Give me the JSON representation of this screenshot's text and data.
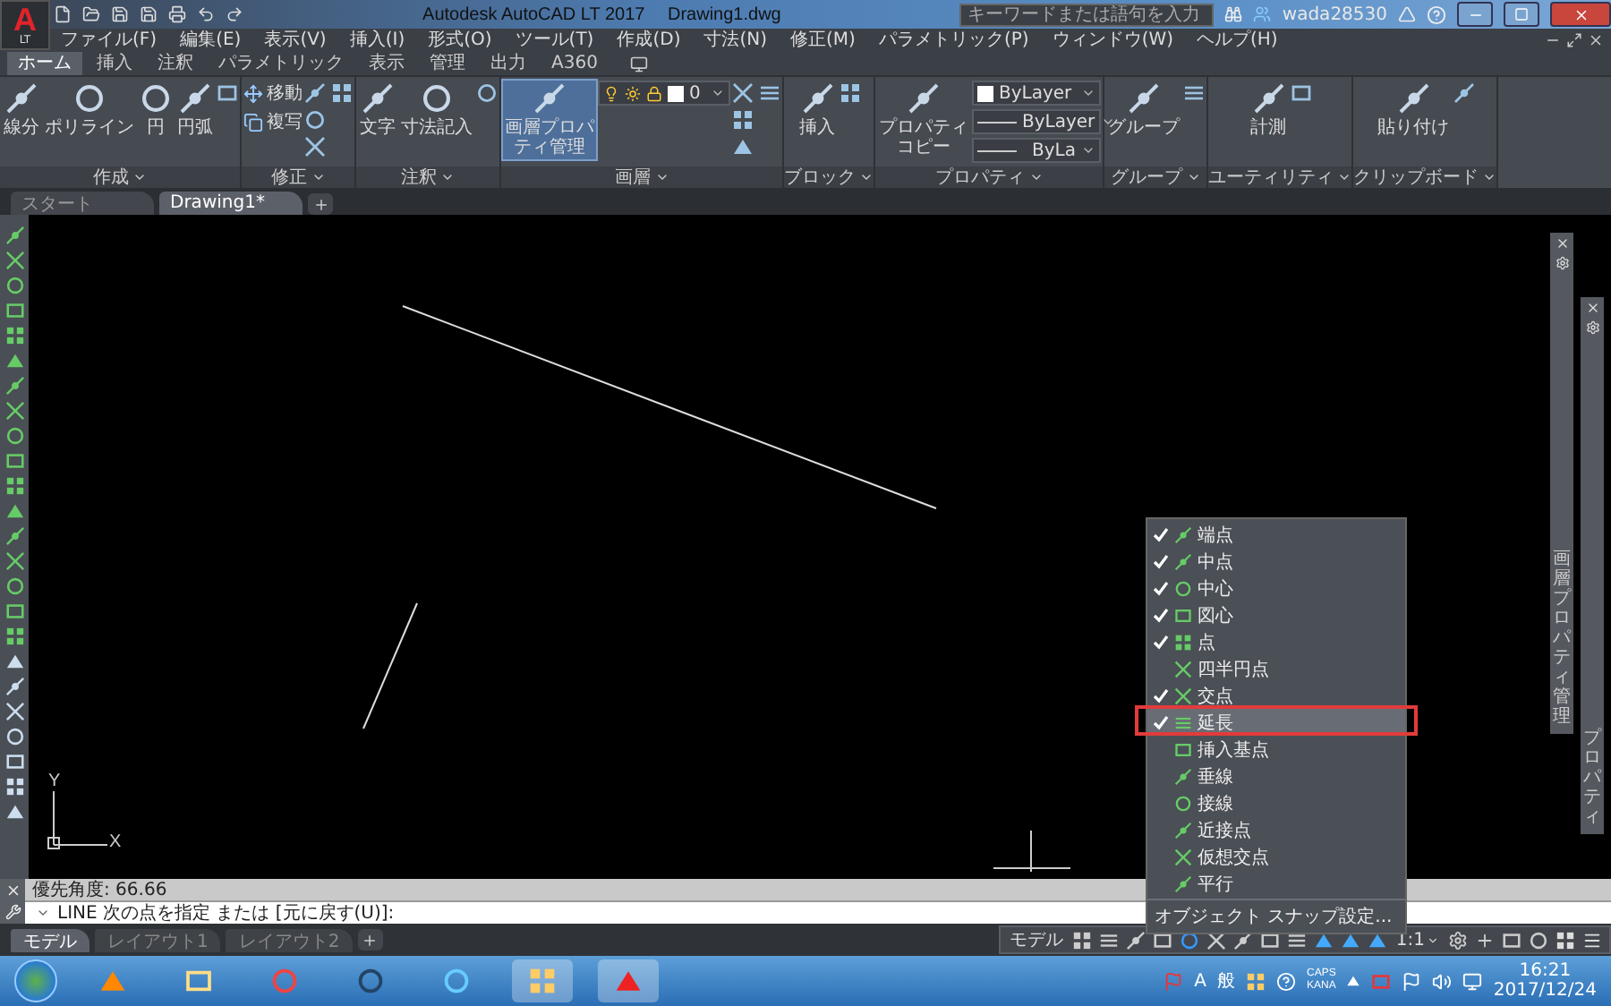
{
  "title_bar": {
    "app_button": {
      "letter": "A",
      "sub": "LT"
    },
    "title": "Autodesk AutoCAD LT 2017",
    "document": "Drawing1.dwg",
    "search": {
      "placeholder": "キーワードまたは語句を入力"
    },
    "user": "wada28530"
  },
  "menu_bar": [
    "ファイル(F)",
    "編集(E)",
    "表示(V)",
    "挿入(I)",
    "形式(O)",
    "ツール(T)",
    "作成(D)",
    "寸法(N)",
    "修正(M)",
    "パラメトリック(P)",
    "ウィンドウ(W)",
    "ヘルプ(H)"
  ],
  "ribbon": {
    "tabs": [
      {
        "label": "ホーム",
        "selected": true
      },
      {
        "label": "挿入",
        "selected": false
      },
      {
        "label": "注釈",
        "selected": false
      },
      {
        "label": "パラメトリック",
        "selected": false
      },
      {
        "label": "表示",
        "selected": false
      },
      {
        "label": "管理",
        "selected": false
      },
      {
        "label": "出力",
        "selected": false
      },
      {
        "label": "A360",
        "selected": false
      }
    ],
    "panels": [
      {
        "title": "作成",
        "tools": [
          {
            "kind": "large",
            "label": "線分",
            "highlighted": false
          },
          {
            "kind": "large",
            "label": "ポリライン",
            "highlighted": false
          },
          {
            "kind": "large",
            "label": "円",
            "highlighted": false
          },
          {
            "kind": "large",
            "label": "円弧",
            "highlighted": false
          }
        ]
      },
      {
        "title": "修正",
        "tools": [
          {
            "kind": "small",
            "label": "移動"
          },
          {
            "kind": "small",
            "label": "複写"
          }
        ]
      },
      {
        "title": "注釈",
        "tools": [
          {
            "kind": "large",
            "label": "文字",
            "highlighted": false
          },
          {
            "kind": "large",
            "label": "寸法記入",
            "highlighted": false
          }
        ]
      },
      {
        "title": "画層",
        "tools": [
          {
            "kind": "large",
            "label": "画層プロパティ管理",
            "highlighted": true
          },
          {
            "kind": "layer",
            "value": "0"
          }
        ]
      },
      {
        "title": "ブロック",
        "tools": [
          {
            "kind": "large",
            "label": "挿入",
            "highlighted": false
          }
        ]
      },
      {
        "title": "プロパティ",
        "tools": [
          {
            "kind": "large",
            "label": "プロパティコピー",
            "highlighted": false
          },
          {
            "kind": "color",
            "value": "ByLayer"
          },
          {
            "kind": "linetype",
            "value": "ByLayer"
          },
          {
            "kind": "lineweight",
            "value": "ByLa"
          }
        ]
      },
      {
        "title": "グループ",
        "tools": [
          {
            "kind": "large",
            "label": "グループ",
            "highlighted": false
          }
        ]
      },
      {
        "title": "ユーティリティ",
        "tools": [
          {
            "kind": "large",
            "label": "計測",
            "highlighted": false
          }
        ]
      },
      {
        "title": "クリップボード",
        "tools": [
          {
            "kind": "large",
            "label": "貼り付け",
            "highlighted": false
          }
        ]
      }
    ]
  },
  "document_tabs": [
    {
      "label": "スタート",
      "selected": false
    },
    {
      "label": "Drawing1*",
      "selected": true
    }
  ],
  "canvas": {
    "ucs": {
      "x": "X",
      "y": "Y"
    }
  },
  "side_palettes": [
    {
      "title": "画層プロパティ管理"
    },
    {
      "title": "プロパティ"
    }
  ],
  "osnap_menu": {
    "items": [
      {
        "label": "端点",
        "checked": true,
        "selected": false
      },
      {
        "label": "中点",
        "checked": true,
        "selected": false
      },
      {
        "label": "中心",
        "checked": true,
        "selected": false
      },
      {
        "label": "図心",
        "checked": true,
        "selected": false
      },
      {
        "label": "点",
        "checked": true,
        "selected": false
      },
      {
        "label": "四半円点",
        "checked": false,
        "selected": false
      },
      {
        "label": "交点",
        "checked": true,
        "selected": false
      },
      {
        "label": "延長",
        "checked": true,
        "selected": true
      },
      {
        "label": "挿入基点",
        "checked": false,
        "selected": false
      },
      {
        "label": "垂線",
        "checked": false,
        "selected": false
      },
      {
        "label": "接線",
        "checked": false,
        "selected": false
      },
      {
        "label": "近接点",
        "checked": false,
        "selected": false
      },
      {
        "label": "仮想交点",
        "checked": false,
        "selected": false
      },
      {
        "label": "平行",
        "checked": false,
        "selected": false
      }
    ],
    "settings": "オブジェクト スナップ設定..."
  },
  "command": {
    "history": "優先角度: 66.66",
    "prompt": "LINE 次の点を指定 または [元に戻す(U)]:"
  },
  "layout_tabs": [
    {
      "label": "モデル",
      "selected": true
    },
    {
      "label": "レイアウト1",
      "selected": false
    },
    {
      "label": "レイアウト2",
      "selected": false
    }
  ],
  "status_bar": {
    "space": "モデル",
    "scale": "1:1"
  },
  "taskbar": {
    "ime_mode": "A",
    "ime_input": "般",
    "caps": "CAPS",
    "kana": "KANA",
    "time": "16:21",
    "date": "2017/12/24"
  }
}
